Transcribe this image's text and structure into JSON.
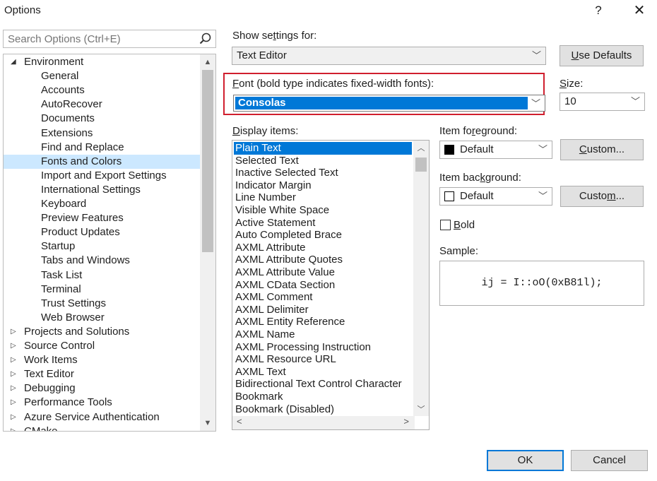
{
  "window": {
    "title": "Options",
    "help_glyph": "?",
    "close_glyph": "✕"
  },
  "search": {
    "placeholder": "Search Options (Ctrl+E)"
  },
  "tree": {
    "items": [
      {
        "label": "Environment",
        "arrow": "◢",
        "level": 0
      },
      {
        "label": "General",
        "level": 1
      },
      {
        "label": "Accounts",
        "level": 1
      },
      {
        "label": "AutoRecover",
        "level": 1
      },
      {
        "label": "Documents",
        "level": 1
      },
      {
        "label": "Extensions",
        "level": 1
      },
      {
        "label": "Find and Replace",
        "level": 1
      },
      {
        "label": "Fonts and Colors",
        "level": 1,
        "selected": true
      },
      {
        "label": "Import and Export Settings",
        "level": 1
      },
      {
        "label": "International Settings",
        "level": 1
      },
      {
        "label": "Keyboard",
        "level": 1
      },
      {
        "label": "Preview Features",
        "level": 1
      },
      {
        "label": "Product Updates",
        "level": 1
      },
      {
        "label": "Startup",
        "level": 1
      },
      {
        "label": "Tabs and Windows",
        "level": 1
      },
      {
        "label": "Task List",
        "level": 1
      },
      {
        "label": "Terminal",
        "level": 1
      },
      {
        "label": "Trust Settings",
        "level": 1
      },
      {
        "label": "Web Browser",
        "level": 1
      },
      {
        "label": "Projects and Solutions",
        "arrow": "▷",
        "level": 0
      },
      {
        "label": "Source Control",
        "arrow": "▷",
        "level": 0
      },
      {
        "label": "Work Items",
        "arrow": "▷",
        "level": 0
      },
      {
        "label": "Text Editor",
        "arrow": "▷",
        "level": 0
      },
      {
        "label": "Debugging",
        "arrow": "▷",
        "level": 0
      },
      {
        "label": "Performance Tools",
        "arrow": "▷",
        "level": 0
      },
      {
        "label": "Azure Service Authentication",
        "arrow": "▷",
        "level": 0
      },
      {
        "label": "CMake",
        "arrow": "▷",
        "level": 0
      }
    ]
  },
  "settings": {
    "show_for_label_pre": "Show se",
    "show_for_label_u": "t",
    "show_for_label_post": "tings for:",
    "show_for_value": "Text Editor",
    "use_defaults_u": "U",
    "use_defaults_rest": "se Defaults"
  },
  "font": {
    "label_u": "F",
    "label_rest": "ont (bold type indicates fixed-width fonts):",
    "value": "Consolas",
    "size_label_u": "S",
    "size_label_rest": "ize:",
    "size_value": "10"
  },
  "display_items": {
    "label_u": "D",
    "label_rest": "isplay items:",
    "items": [
      "Plain Text",
      "Selected Text",
      "Inactive Selected Text",
      "Indicator Margin",
      "Line Number",
      "Visible White Space",
      "Active Statement",
      "Auto Completed Brace",
      "AXML Attribute",
      "AXML Attribute Quotes",
      "AXML Attribute Value",
      "AXML CData Section",
      "AXML Comment",
      "AXML Delimiter",
      "AXML Entity Reference",
      "AXML Name",
      "AXML Processing Instruction",
      "AXML Resource URL",
      "AXML Text",
      "Bidirectional Text Control Character",
      "Bookmark",
      "Bookmark (Disabled)"
    ],
    "selected_index": 0
  },
  "foreground": {
    "label_pre": "Item fo",
    "label_u": "r",
    "label_post": "eground:",
    "value": "Default",
    "swatch_color": "#000000",
    "custom_pre": "",
    "custom_u": "C",
    "custom_post": "ustom..."
  },
  "background": {
    "label_pre": "Item bac",
    "label_u": "k",
    "label_post": "ground:",
    "value": "Default",
    "swatch_color": "#ffffff",
    "custom_pre": "Custo",
    "custom_u": "m",
    "custom_post": "..."
  },
  "bold": {
    "label_u": "B",
    "label_rest": "old",
    "checked": false
  },
  "sample": {
    "label": "Sample:",
    "text": "ij = I::oO(0xB81l);"
  },
  "footer": {
    "ok": "OK",
    "cancel": "Cancel"
  },
  "colors": {
    "accent": "#0078d7",
    "selection_light": "#cce8ff",
    "highlight_border": "#d01f2e"
  }
}
